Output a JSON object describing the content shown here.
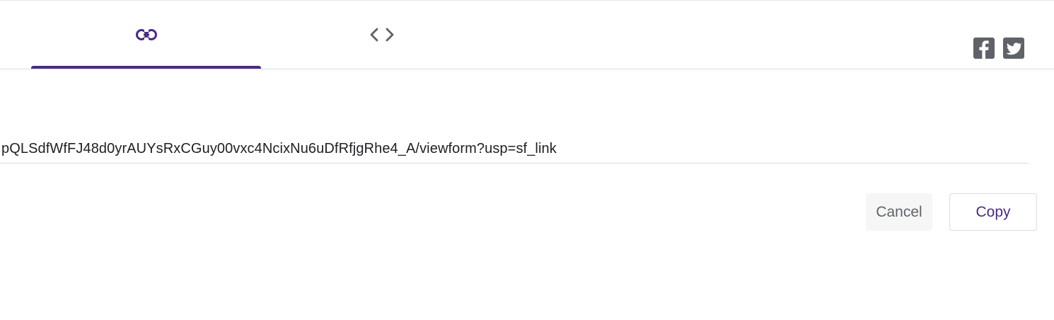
{
  "tabs": [
    {
      "name": "link",
      "icon": "link-icon",
      "selected": true
    },
    {
      "name": "embed",
      "icon": "code-icon",
      "selected": false
    }
  ],
  "social": [
    {
      "icon": "facebook-icon"
    },
    {
      "icon": "twitter-icon"
    }
  ],
  "url_field": {
    "value": "pQLSdfWfFJ48d0yrAUYsRxCGuy00vxc4NcixNu6uDfRfjgRhe4_A/viewform?usp=sf_link"
  },
  "actions": {
    "cancel_label": "Cancel",
    "copy_label": "Copy"
  },
  "colors": {
    "accent": "#4b2a87",
    "icon_gray": "#5f6368",
    "divider": "#dadce0"
  }
}
